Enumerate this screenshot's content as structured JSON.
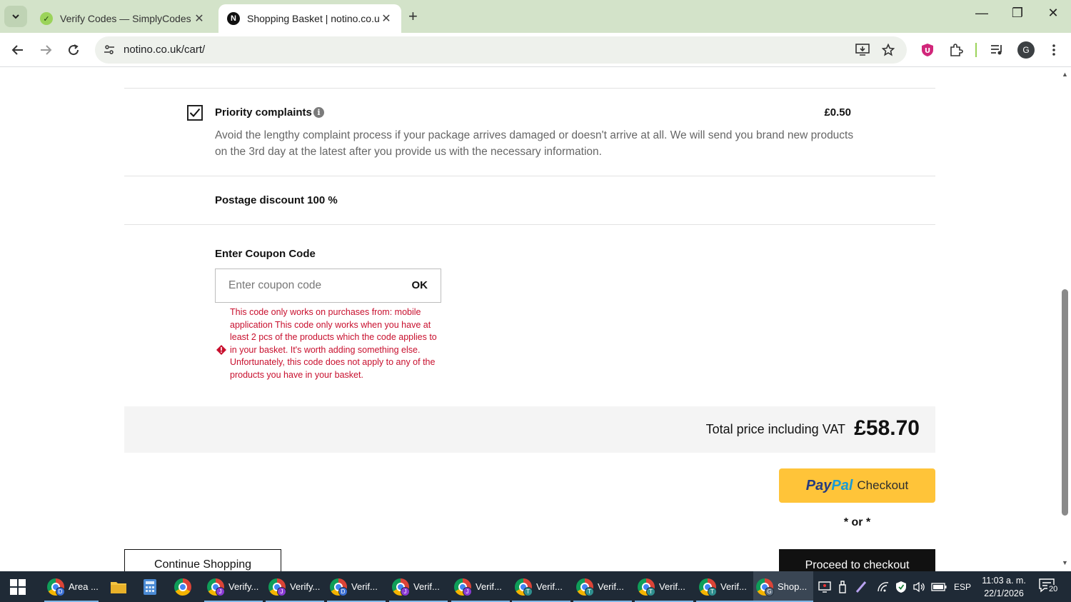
{
  "browser": {
    "tabs": [
      {
        "title": "Verify Codes — SimplyCodes",
        "active": false
      },
      {
        "title": "Shopping Basket | notino.co.uk",
        "active": true
      }
    ],
    "url": "notino.co.uk/cart/"
  },
  "priority_complaints": {
    "title": "Priority complaints",
    "price": "£0.50",
    "checked": true,
    "description": "Avoid the lengthy complaint process if your package arrives damaged or doesn't arrive at all. We will send you brand new products on the 3rd day at the latest after you provide us with the necessary information."
  },
  "postage_discount": "Postage discount 100 %",
  "coupon": {
    "label": "Enter Coupon Code",
    "placeholder": "Enter coupon code",
    "value": "",
    "ok_label": "OK",
    "error": "This code only works on purchases from: mobile application This code only works when you have at least 2 pcs of the products which the code applies to in your basket. It's worth adding something else. Unfortunately, this code does not apply to any of the products you have in your basket."
  },
  "total": {
    "label": "Total price including VAT",
    "value": "£58.70"
  },
  "paypal": {
    "brand_pay": "Pay",
    "brand_pal": "Pal",
    "label": "Checkout"
  },
  "or_text": "* or *",
  "continue_label": "Continue Shopping",
  "checkout_label": "Proceed to checkout",
  "taskbar": {
    "apps": [
      {
        "label": "Area ...",
        "badge": "D",
        "running": true
      },
      {
        "label": "",
        "icon": "file-explorer-icon"
      },
      {
        "label": "",
        "icon": "calculator-icon"
      },
      {
        "label": "",
        "icon": "chrome-icon"
      },
      {
        "label": "Verify...",
        "badge": "J",
        "running": true
      },
      {
        "label": "Verify...",
        "badge": "J",
        "running": true
      },
      {
        "label": "Verif...",
        "badge": "D",
        "running": true
      },
      {
        "label": "Verif...",
        "badge": "J",
        "running": true
      },
      {
        "label": "Verif...",
        "badge": "J",
        "running": true
      },
      {
        "label": "Verif...",
        "badge": "T",
        "running": true
      },
      {
        "label": "Verif...",
        "badge": "T",
        "running": true
      },
      {
        "label": "Verif...",
        "badge": "T",
        "running": true
      },
      {
        "label": "Verif...",
        "badge": "T",
        "running": true
      },
      {
        "label": "Shop...",
        "badge": "G",
        "running": true,
        "current": true
      }
    ],
    "language": "ESP",
    "time": "11:03 a. m.",
    "date": "22/1/2026",
    "notifications": "20"
  }
}
